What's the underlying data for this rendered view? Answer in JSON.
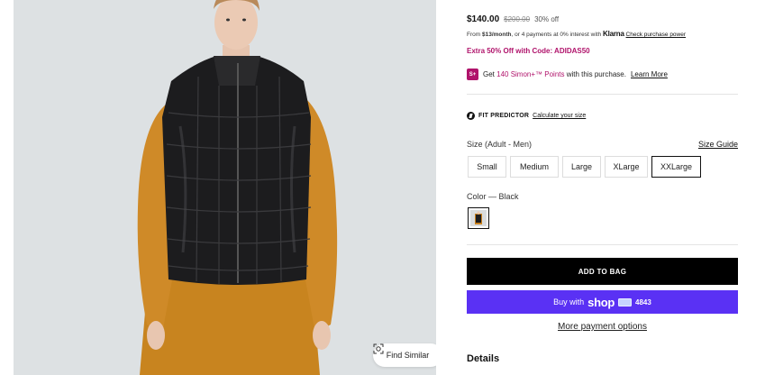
{
  "product_image": {
    "alt": "Model wearing black quilted puffer vest over orange top",
    "find_similar_label": "Find Similar"
  },
  "pricing": {
    "current": "$140.00",
    "original": "$200.00",
    "discount": "30% off"
  },
  "klarna": {
    "prefix": "From ",
    "monthly": "$13/month",
    "middle": ", or 4 payments at 0% interest with ",
    "brand": "Klarna",
    "link": "Check purchase power"
  },
  "promo_text": "Extra 50% Off with Code: ADIDAS50",
  "points": {
    "badge": "S+",
    "prefix": "Get ",
    "amount": "140 Simon+™ Points",
    "suffix": " with this purchase.",
    "link": "Learn More"
  },
  "fit_predictor": {
    "label": "FIT PREDICTOR",
    "link": "Calculate your size"
  },
  "size": {
    "label": "Size (Adult - Men)",
    "guide": "Size Guide",
    "options": [
      "Small",
      "Medium",
      "Large",
      "XLarge",
      "XXLarge"
    ],
    "selected": "XXLarge"
  },
  "color": {
    "label": "Color — Black"
  },
  "actions": {
    "add_to_bag": "ADD TO BAG",
    "shop_pay_prefix": "Buy with",
    "shop_pay_brand": "shop",
    "shop_pay_card": "4843",
    "more_payment": "More payment options"
  },
  "details": {
    "heading": "Details"
  },
  "colors": {
    "accent_magenta": "#b0136b",
    "shop_pay_purple": "#5a31f4",
    "vest_black": "#1c1c1e",
    "shirt_orange": "#c9821f"
  }
}
